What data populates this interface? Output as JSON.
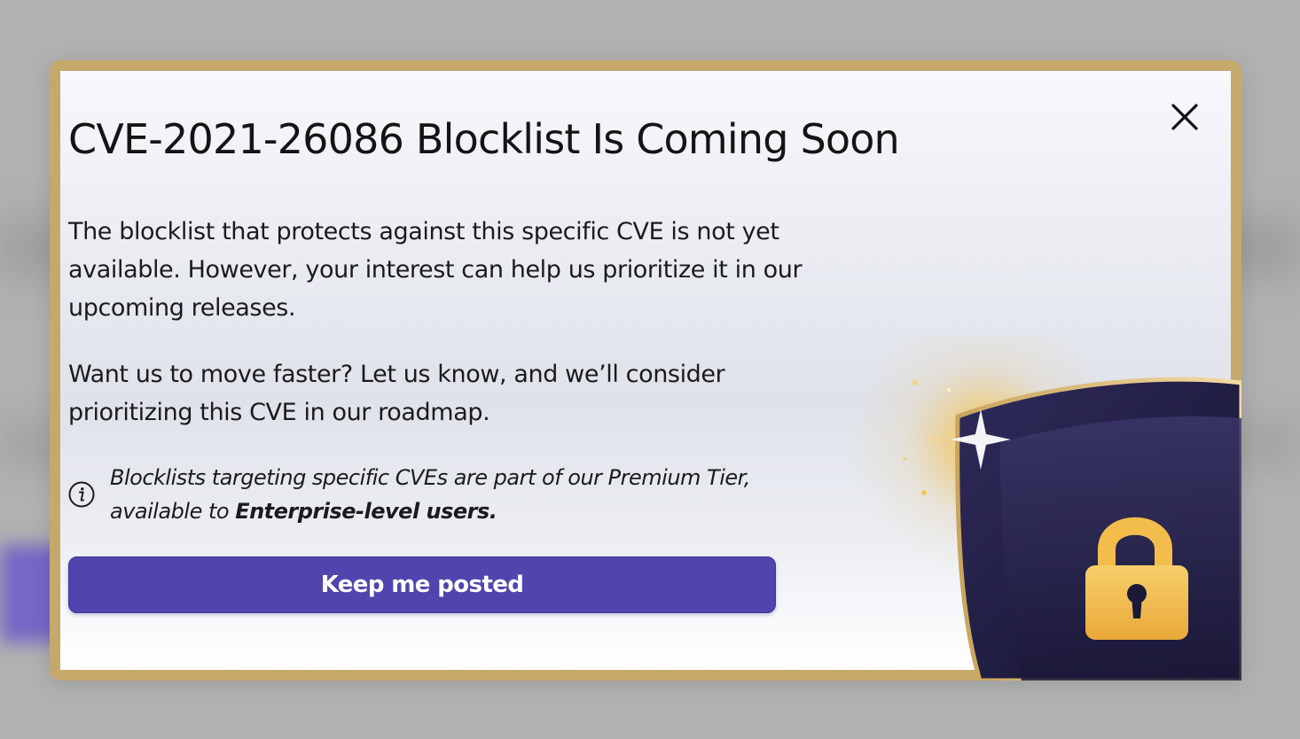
{
  "dialog": {
    "title": "CVE-2021-26086 Blocklist Is Coming Soon",
    "paragraph_1": "The blocklist that protects against this specific CVE is not yet available. However, your interest can help us prioritize it in our upcoming releases.",
    "paragraph_2": "Want us to move faster? Let us know, and we’ll consider prioritizing this CVE in our roadmap.",
    "info_note": {
      "icon": "info-icon",
      "text": "Blocklists targeting specific CVEs are part of our Premium Tier, available to ",
      "emphasis": "Enterprise-level users."
    },
    "primary_button_label": "Keep me posted",
    "close_icon": "close-icon",
    "illustration_icons": [
      "shield-icon",
      "padlock-icon"
    ]
  },
  "colors": {
    "frame_gold": "#c4a96a",
    "button_purple": "#5045ae",
    "shield_navy": "#1f1c3f",
    "lock_gold": "#f3bd49",
    "backdrop_gray": "#b1b1b1"
  }
}
